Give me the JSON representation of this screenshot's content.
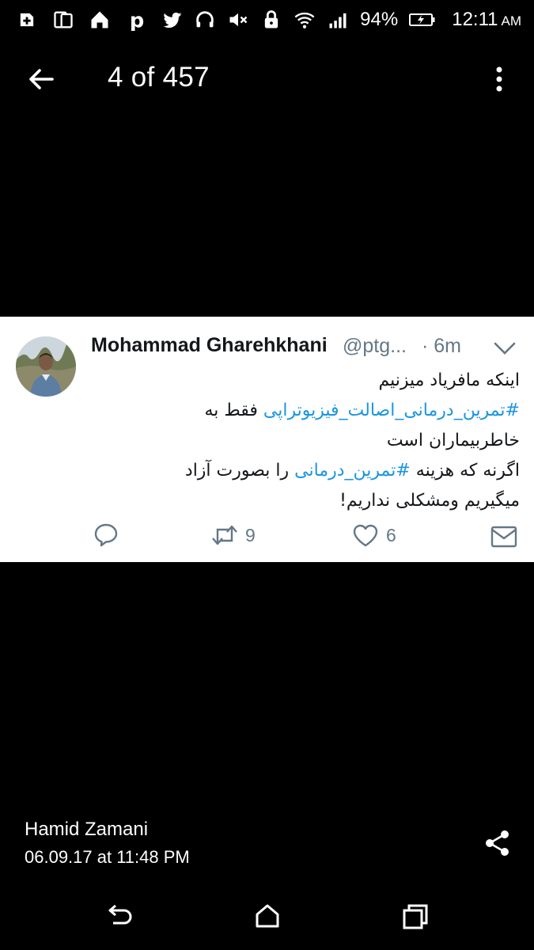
{
  "status_bar": {
    "battery_percent": "94%",
    "time": "12:11",
    "ampm": "AM",
    "left_icons": [
      "add-box-icon",
      "dual-screen-icon",
      "home-app-icon",
      "pinterest-icon",
      "twitter-icon"
    ],
    "right_icons": [
      "headset-icon",
      "volume-mute-icon",
      "lock-icon",
      "wifi-icon",
      "cell-signal-icon",
      "battery-charging-icon"
    ]
  },
  "app_bar": {
    "title": "4 of 457"
  },
  "tweet": {
    "author_name": "Mohammad Gharehkhani",
    "handle": "@ptg...",
    "time": "· 6m",
    "body_lines": [
      {
        "text": "اینکه مافریاد میزنیم"
      },
      {
        "hashtag": "#تمرین_درمانی_اصالت_فیزیوتراپی",
        "after": " فقط به"
      },
      {
        "text": "خاطربیماران است"
      },
      {
        "before": "اگرنه که هزینه ",
        "hashtag": "#تمرین_درمانی",
        "after": " را بصورت آزاد"
      },
      {
        "text": "میگیریم ومشکلی نداریم!"
      }
    ],
    "retweet_count": "9",
    "like_count": "6"
  },
  "footer": {
    "sharer_name": "Hamid Zamani",
    "shared_date": "06.09.17 at 11:48 PM"
  },
  "colors": {
    "background": "#000000",
    "card": "#ffffff",
    "hashtag": "#1b95e0",
    "muted": "#657786",
    "text_dark": "#14171a"
  }
}
